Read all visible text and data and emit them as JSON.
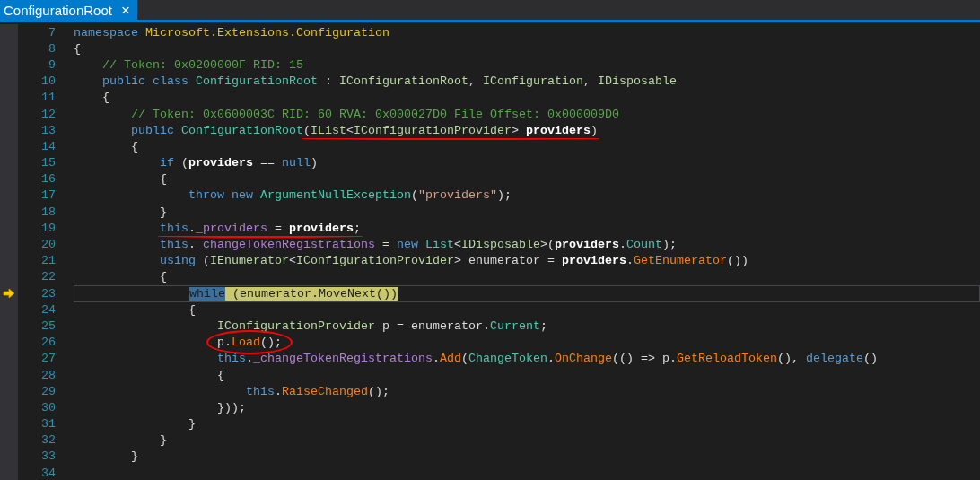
{
  "tab": {
    "title": "ConfigurationRoot",
    "close": "×",
    "selected": true
  },
  "lines": [
    {
      "number": "7",
      "tokens": [
        {
          "text": "namespace ",
          "kind": "kw"
        },
        {
          "text": "Microsoft.Extensions.Configuration",
          "kind": "ns"
        }
      ]
    },
    {
      "number": "8",
      "tokens": [
        {
          "text": "{",
          "kind": "plain"
        }
      ],
      "children": [
        {
          "number": "9",
          "tokens": [
            {
              "text": "// Token: 0x0200000F RID: 15",
              "kind": "comment"
            }
          ]
        },
        {
          "number": "10",
          "tokens": [
            {
              "text": "public class ",
              "kind": "kw"
            },
            {
              "text": "ConfigurationRoot",
              "kind": "type"
            },
            {
              "text": " : ",
              "kind": "plain"
            },
            {
              "text": "IConfigurationRoot",
              "kind": "iface"
            },
            {
              "text": ", ",
              "kind": "plain"
            },
            {
              "text": "IConfiguration",
              "kind": "iface"
            },
            {
              "text": ", ",
              "kind": "plain"
            },
            {
              "text": "IDisposable",
              "kind": "iface"
            }
          ]
        },
        {
          "number": "11",
          "tokens": [
            {
              "text": "{",
              "kind": "plain"
            }
          ],
          "children": [
            {
              "number": "12",
              "tokens": [
                {
                  "text": "// Token: 0x0600003C RID: 60 RVA: 0x000027D0 File Offset: 0x000009D0",
                  "kind": "comment"
                }
              ]
            },
            {
              "number": "13",
              "tokens": [
                {
                  "text": "public ",
                  "kind": "kw"
                },
                {
                  "text": "ConfigurationRoot",
                  "kind": "type"
                }
              ],
              "annotation": {
                "kind": "underline",
                "tokens": [
                  {
                    "text": "(",
                    "kind": "plain"
                  },
                  {
                    "text": "IList",
                    "kind": "iface"
                  },
                  {
                    "text": "<",
                    "kind": "plain"
                  },
                  {
                    "text": "IConfigurationProvider",
                    "kind": "iface"
                  },
                  {
                    "text": "> ",
                    "kind": "plain"
                  },
                  {
                    "text": "providers",
                    "kind": "param"
                  },
                  {
                    "text": ")",
                    "kind": "plain"
                  }
                ]
              }
            },
            {
              "number": "14",
              "tokens": [
                {
                  "text": "{",
                  "kind": "plain"
                }
              ],
              "children": [
                {
                  "number": "15",
                  "tokens": [
                    {
                      "text": "if ",
                      "kind": "kw"
                    },
                    {
                      "text": "(",
                      "kind": "plain"
                    },
                    {
                      "text": "providers",
                      "kind": "param"
                    },
                    {
                      "text": " == ",
                      "kind": "plain"
                    },
                    {
                      "text": "null",
                      "kind": "kw"
                    },
                    {
                      "text": ")",
                      "kind": "plain"
                    }
                  ]
                },
                {
                  "number": "16",
                  "tokens": [
                    {
                      "text": "{",
                      "kind": "plain"
                    }
                  ],
                  "children": [
                    {
                      "number": "17",
                      "tokens": [
                        {
                          "text": "throw new ",
                          "kind": "kw"
                        },
                        {
                          "text": "ArgumentNullException",
                          "kind": "type"
                        },
                        {
                          "text": "(",
                          "kind": "plain"
                        },
                        {
                          "text": "\"providers\"",
                          "kind": "str"
                        },
                        {
                          "text": ");",
                          "kind": "plain"
                        }
                      ]
                    }
                  ]
                },
                {
                  "number": "18",
                  "tokens": [
                    {
                      "text": "}",
                      "kind": "plain"
                    }
                  ]
                },
                {
                  "number": "19",
                  "annotation": {
                    "kind": "underline",
                    "tokens": [
                      {
                        "text": "this",
                        "kind": "kw"
                      },
                      {
                        "text": ".",
                        "kind": "plain"
                      },
                      {
                        "text": "_providers",
                        "kind": "field"
                      },
                      {
                        "text": " = ",
                        "kind": "plain"
                      },
                      {
                        "text": "providers",
                        "kind": "param"
                      },
                      {
                        "text": ";",
                        "kind": "plain"
                      }
                    ]
                  }
                },
                {
                  "number": "20",
                  "tokens": [
                    {
                      "text": "this",
                      "kind": "kw"
                    },
                    {
                      "text": ".",
                      "kind": "plain"
                    },
                    {
                      "text": "_changeTokenRegistrations",
                      "kind": "field"
                    },
                    {
                      "text": " = ",
                      "kind": "plain"
                    },
                    {
                      "text": "new ",
                      "kind": "kw"
                    },
                    {
                      "text": "List",
                      "kind": "type"
                    },
                    {
                      "text": "<",
                      "kind": "plain"
                    },
                    {
                      "text": "IDisposable",
                      "kind": "iface"
                    },
                    {
                      "text": ">(",
                      "kind": "plain"
                    },
                    {
                      "text": "providers",
                      "kind": "param"
                    },
                    {
                      "text": ".",
                      "kind": "plain"
                    },
                    {
                      "text": "Count",
                      "kind": "prop"
                    },
                    {
                      "text": ");",
                      "kind": "plain"
                    }
                  ]
                },
                {
                  "number": "21",
                  "tokens": [
                    {
                      "text": "using ",
                      "kind": "kw"
                    },
                    {
                      "text": "(",
                      "kind": "plain"
                    },
                    {
                      "text": "IEnumerator",
                      "kind": "iface"
                    },
                    {
                      "text": "<",
                      "kind": "plain"
                    },
                    {
                      "text": "IConfigurationProvider",
                      "kind": "iface"
                    },
                    {
                      "text": "> enumerator = ",
                      "kind": "plain"
                    },
                    {
                      "text": "providers",
                      "kind": "param"
                    },
                    {
                      "text": ".",
                      "kind": "plain"
                    },
                    {
                      "text": "GetEnumerator",
                      "kind": "method"
                    },
                    {
                      "text": "())",
                      "kind": "plain"
                    }
                  ]
                },
                {
                  "number": "22",
                  "tokens": [
                    {
                      "text": "{",
                      "kind": "plain"
                    }
                  ],
                  "children": [
                    {
                      "number": "23",
                      "current": true,
                      "tokens": [
                        {
                          "text": "while",
                          "kind": "kw",
                          "selected": true
                        },
                        {
                          "text": " (enumerator.MoveNext())",
                          "kind": "plain",
                          "highlighted": true
                        }
                      ]
                    },
                    {
                      "number": "24",
                      "tokens": [
                        {
                          "text": "{",
                          "kind": "plain"
                        }
                      ],
                      "children": [
                        {
                          "number": "25",
                          "tokens": [
                            {
                              "text": "IConfigurationProvider",
                              "kind": "iface"
                            },
                            {
                              "text": " p = enumerator.",
                              "kind": "plain"
                            },
                            {
                              "text": "Current",
                              "kind": "prop"
                            },
                            {
                              "text": ";",
                              "kind": "plain"
                            }
                          ]
                        },
                        {
                          "number": "26",
                          "annotation": {
                            "kind": "circle",
                            "tokens": [
                              {
                                "text": "p.",
                                "kind": "plain"
                              },
                              {
                                "text": "Load",
                                "kind": "method"
                              },
                              {
                                "text": "();",
                                "kind": "plain"
                              }
                            ]
                          }
                        },
                        {
                          "number": "27",
                          "tokens": [
                            {
                              "text": "this",
                              "kind": "kw"
                            },
                            {
                              "text": ".",
                              "kind": "plain"
                            },
                            {
                              "text": "_changeTokenRegistrations",
                              "kind": "field"
                            },
                            {
                              "text": ".",
                              "kind": "plain"
                            },
                            {
                              "text": "Add",
                              "kind": "method"
                            },
                            {
                              "text": "(",
                              "kind": "plain"
                            },
                            {
                              "text": "ChangeToken",
                              "kind": "type"
                            },
                            {
                              "text": ".",
                              "kind": "plain"
                            },
                            {
                              "text": "OnChange",
                              "kind": "method"
                            },
                            {
                              "text": "(() => p.",
                              "kind": "plain"
                            },
                            {
                              "text": "GetReloadToken",
                              "kind": "method"
                            },
                            {
                              "text": "(), ",
                              "kind": "plain"
                            },
                            {
                              "text": "delegate",
                              "kind": "kw"
                            },
                            {
                              "text": "()",
                              "kind": "plain"
                            }
                          ]
                        },
                        {
                          "number": "28",
                          "tokens": [
                            {
                              "text": "{",
                              "kind": "plain"
                            }
                          ],
                          "children": [
                            {
                              "number": "29",
                              "tokens": [
                                {
                                  "text": "this",
                                  "kind": "kw"
                                },
                                {
                                  "text": ".",
                                  "kind": "plain"
                                },
                                {
                                  "text": "RaiseChanged",
                                  "kind": "method"
                                },
                                {
                                  "text": "();",
                                  "kind": "plain"
                                }
                              ]
                            }
                          ]
                        },
                        {
                          "number": "30",
                          "tokens": [
                            {
                              "text": "}));",
                              "kind": "plain"
                            }
                          ]
                        }
                      ]
                    },
                    {
                      "number": "31",
                      "tokens": [
                        {
                          "text": "}",
                          "kind": "plain"
                        }
                      ]
                    }
                  ]
                },
                {
                  "number": "32",
                  "tokens": [
                    {
                      "text": "}",
                      "kind": "plain"
                    }
                  ]
                }
              ]
            },
            {
              "number": "33",
              "tokens": [
                {
                  "text": "}",
                  "kind": "plain"
                }
              ]
            },
            {
              "number": "34"
            }
          ]
        }
      ]
    }
  ]
}
